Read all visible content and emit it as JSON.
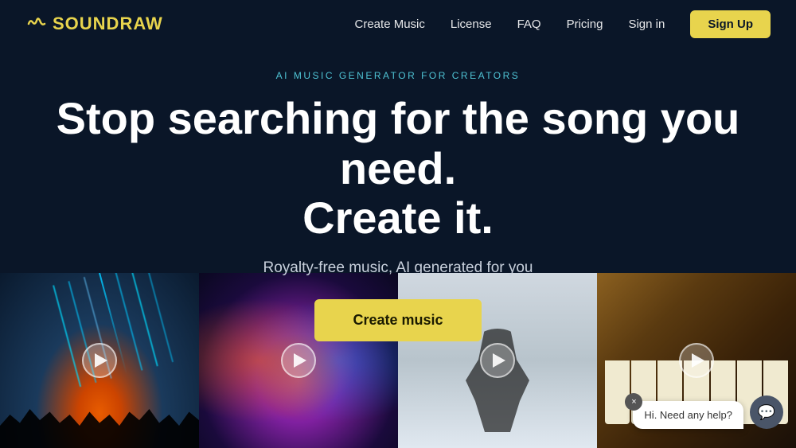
{
  "header": {
    "logo_text": "SOUNDRAW",
    "nav_items": [
      {
        "label": "Create Music",
        "href": "#"
      },
      {
        "label": "License",
        "href": "#"
      },
      {
        "label": "FAQ",
        "href": "#"
      },
      {
        "label": "Pricing",
        "href": "#"
      },
      {
        "label": "Sign in",
        "href": "#"
      }
    ],
    "signup_label": "Sign Up"
  },
  "hero": {
    "tag": "AI MUSIC GENERATOR FOR CREATORS",
    "title_line1": "Stop searching for the song you need.",
    "title_line2": "Create it.",
    "subtitle": "Royalty-free music, AI generated for you",
    "cta_label": "Create music"
  },
  "chat": {
    "message": "Hi. Need any help?",
    "close_label": "×",
    "icon": "💬"
  }
}
